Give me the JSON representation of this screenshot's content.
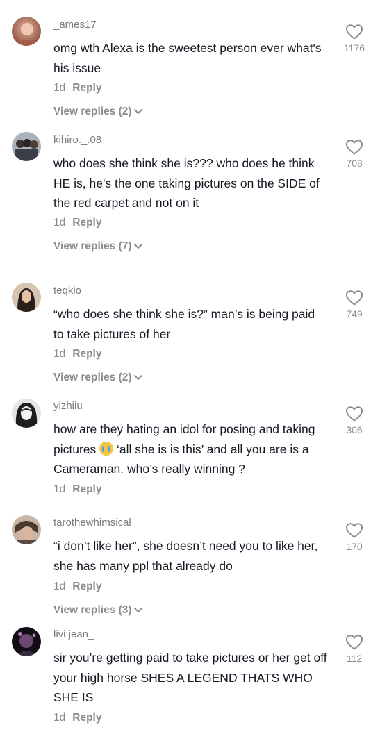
{
  "comments": [
    {
      "username": "_ames17",
      "text": "omg wth Alexa is the sweetest person ever what's his issue",
      "time": "1d",
      "reply_label": "Reply",
      "view_replies": "View replies (2)",
      "likes": "1176",
      "avatar_colors": [
        "#d9a58c",
        "#8a4b3a"
      ]
    },
    {
      "username": "kihiro._.08",
      "text": "who does she think she is??? who does he think HE is, he's the one taking pictures on the SIDE of the red carpet and not on it",
      "time": "1d",
      "reply_label": "Reply",
      "view_replies": "View replies (7)",
      "likes": "708",
      "avatar_colors": [
        "#9aa3ad",
        "#3a3f47"
      ]
    },
    {
      "username": "teqkio",
      "text": "“who does she think she is?” man’s is being paid to take pictures of her",
      "time": "1d",
      "reply_label": "Reply",
      "view_replies": "View replies (2)",
      "likes": "749",
      "avatar_colors": [
        "#c9b29d",
        "#2a1f1a"
      ]
    },
    {
      "username": "yizhiiu",
      "text_before_emoji": "how are they hating an idol for posing and taking pictures ",
      "emoji": "crying-face",
      "text_after_emoji": " ‘all she is is this’ and all you are is a Cameraman. who’s really winning ?",
      "time": "1d",
      "reply_label": "Reply",
      "likes": "306",
      "avatar_colors": [
        "#d8d8d8",
        "#1e1e1e"
      ]
    },
    {
      "username": "tarothewhimsical",
      "text": "“i don’t like her”, she doesn’t need you to like her, she has many ppl that already do",
      "time": "1d",
      "reply_label": "Reply",
      "view_replies": "View replies (3)",
      "likes": "170",
      "avatar_colors": [
        "#b39a86",
        "#4a3a30"
      ]
    },
    {
      "username": "livi.jean_",
      "text": "sir you’re getting paid to take pictures or her get off your high horse SHES A LEGEND THATS WHO SHE IS",
      "time": "1d",
      "reply_label": "Reply",
      "likes": "112",
      "avatar_colors": [
        "#5a3d5e",
        "#120d14"
      ]
    }
  ],
  "icons": {
    "like": "heart-outline-icon",
    "expand": "chevron-down-icon"
  }
}
